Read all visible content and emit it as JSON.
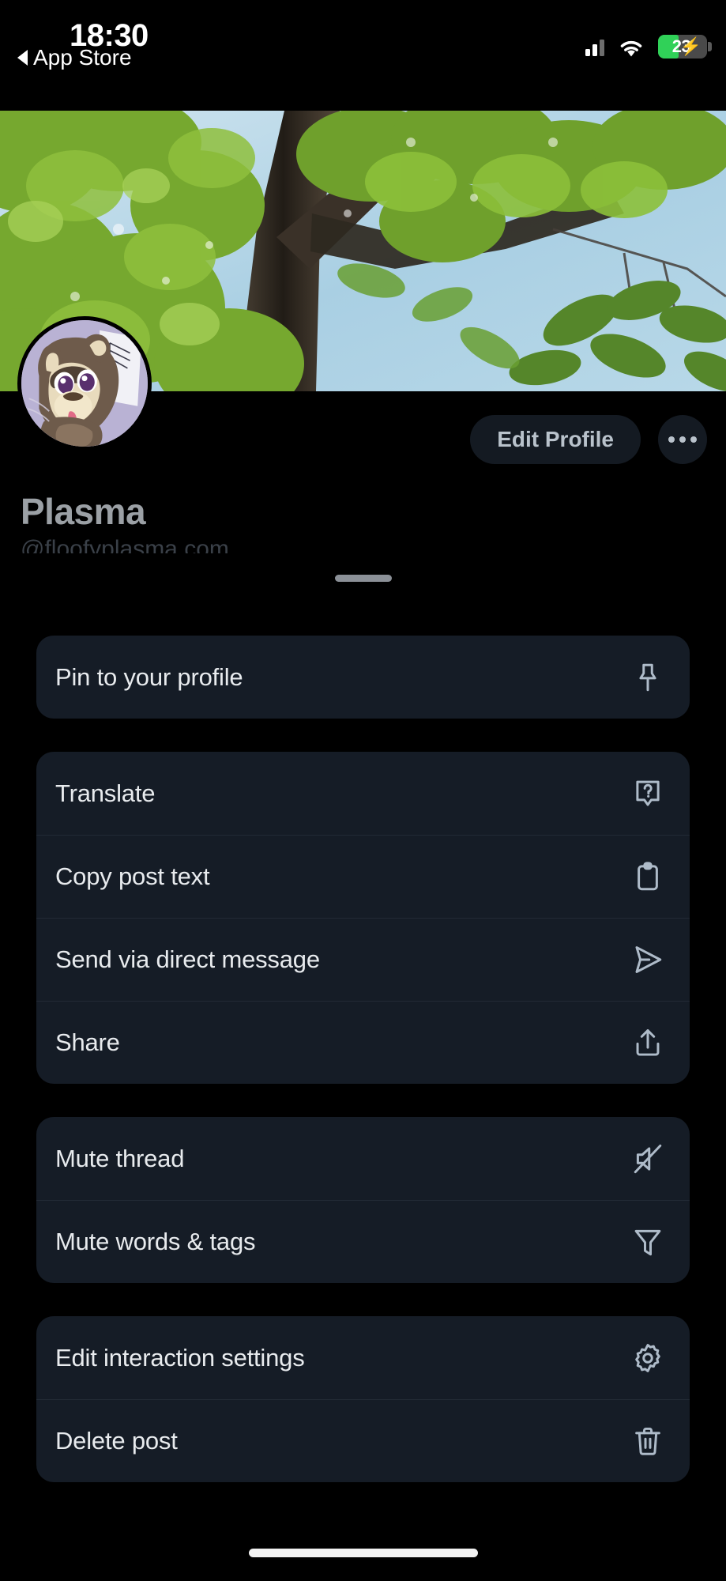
{
  "status_bar": {
    "time": "18:30",
    "back_label": "App Store",
    "back_icon": "triangle-left-icon",
    "signal_icon": "cellular-signal-icon",
    "wifi_icon": "wifi-icon",
    "battery_percent": "23",
    "battery_charging_icon": "lightning-bolt-icon",
    "battery_color": "#30d158"
  },
  "profile": {
    "banner_icon": "tree-banner-image",
    "avatar_icon": "raccoon-avatar-image",
    "display_name": "Plasma",
    "handle": "@floofyplasma.com",
    "edit_profile_label": "Edit Profile",
    "more_label": "•••",
    "more_icon": "ellipsis-icon"
  },
  "sheet": {
    "grabber_icon": "drag-handle-icon",
    "groups": [
      {
        "items": [
          {
            "label": "Pin to your profile",
            "icon": "pin-icon"
          }
        ]
      },
      {
        "items": [
          {
            "label": "Translate",
            "icon": "translate-question-bubble-icon"
          },
          {
            "label": "Copy post text",
            "icon": "clipboard-icon"
          },
          {
            "label": "Send via direct message",
            "icon": "paper-plane-icon"
          },
          {
            "label": "Share",
            "icon": "share-upload-icon"
          }
        ]
      },
      {
        "items": [
          {
            "label": "Mute thread",
            "icon": "speaker-mute-icon"
          },
          {
            "label": "Mute words & tags",
            "icon": "filter-funnel-icon"
          }
        ]
      },
      {
        "items": [
          {
            "label": "Edit interaction settings",
            "icon": "gear-icon"
          },
          {
            "label": "Delete post",
            "icon": "trash-icon"
          }
        ]
      }
    ]
  },
  "system": {
    "home_indicator": "home-indicator"
  },
  "colors": {
    "background": "#000000",
    "card": "#151c26",
    "icon": "#aebbc9",
    "text": "#e8ebee",
    "muted": "#9ba0a5",
    "accent_green": "#30d158"
  }
}
